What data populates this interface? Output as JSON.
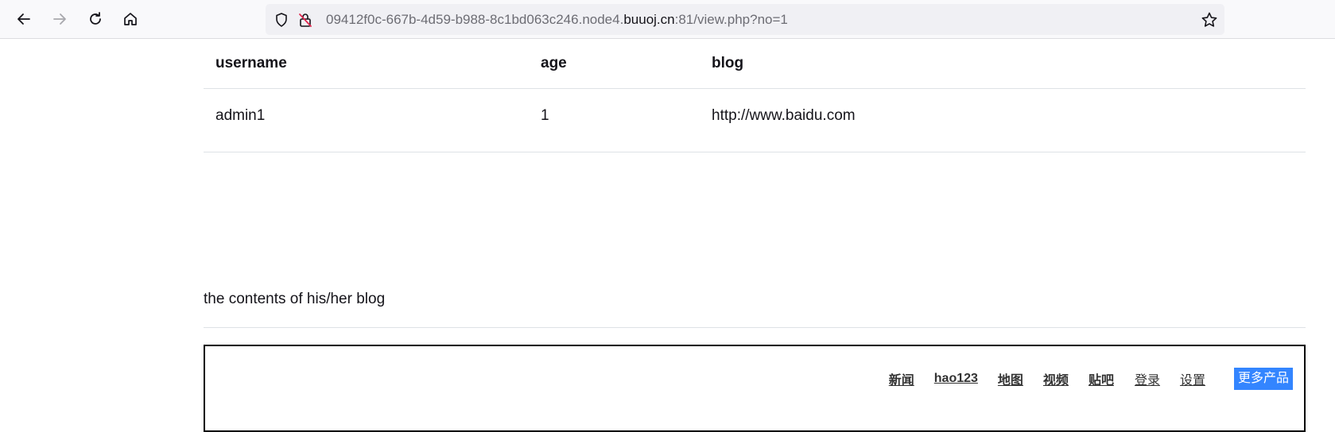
{
  "browser": {
    "url_prefix": "09412f0c-667b-4d59-b988-8c1bd063c246.node4.",
    "url_host": "buuoj.cn",
    "url_suffix": ":81/view.php?no=1"
  },
  "table": {
    "headers": [
      "username",
      "age",
      "blog"
    ],
    "rows": [
      [
        "admin1",
        "1",
        "http://www.baidu.com"
      ]
    ]
  },
  "blog_caption": "the contents of his/her blog",
  "embedded": {
    "links": [
      "新闻",
      "hao123",
      "地图",
      "视频",
      "贴吧"
    ],
    "login": "登录",
    "settings": "设置",
    "more": "更多产品",
    "accent": "#3385ff"
  }
}
